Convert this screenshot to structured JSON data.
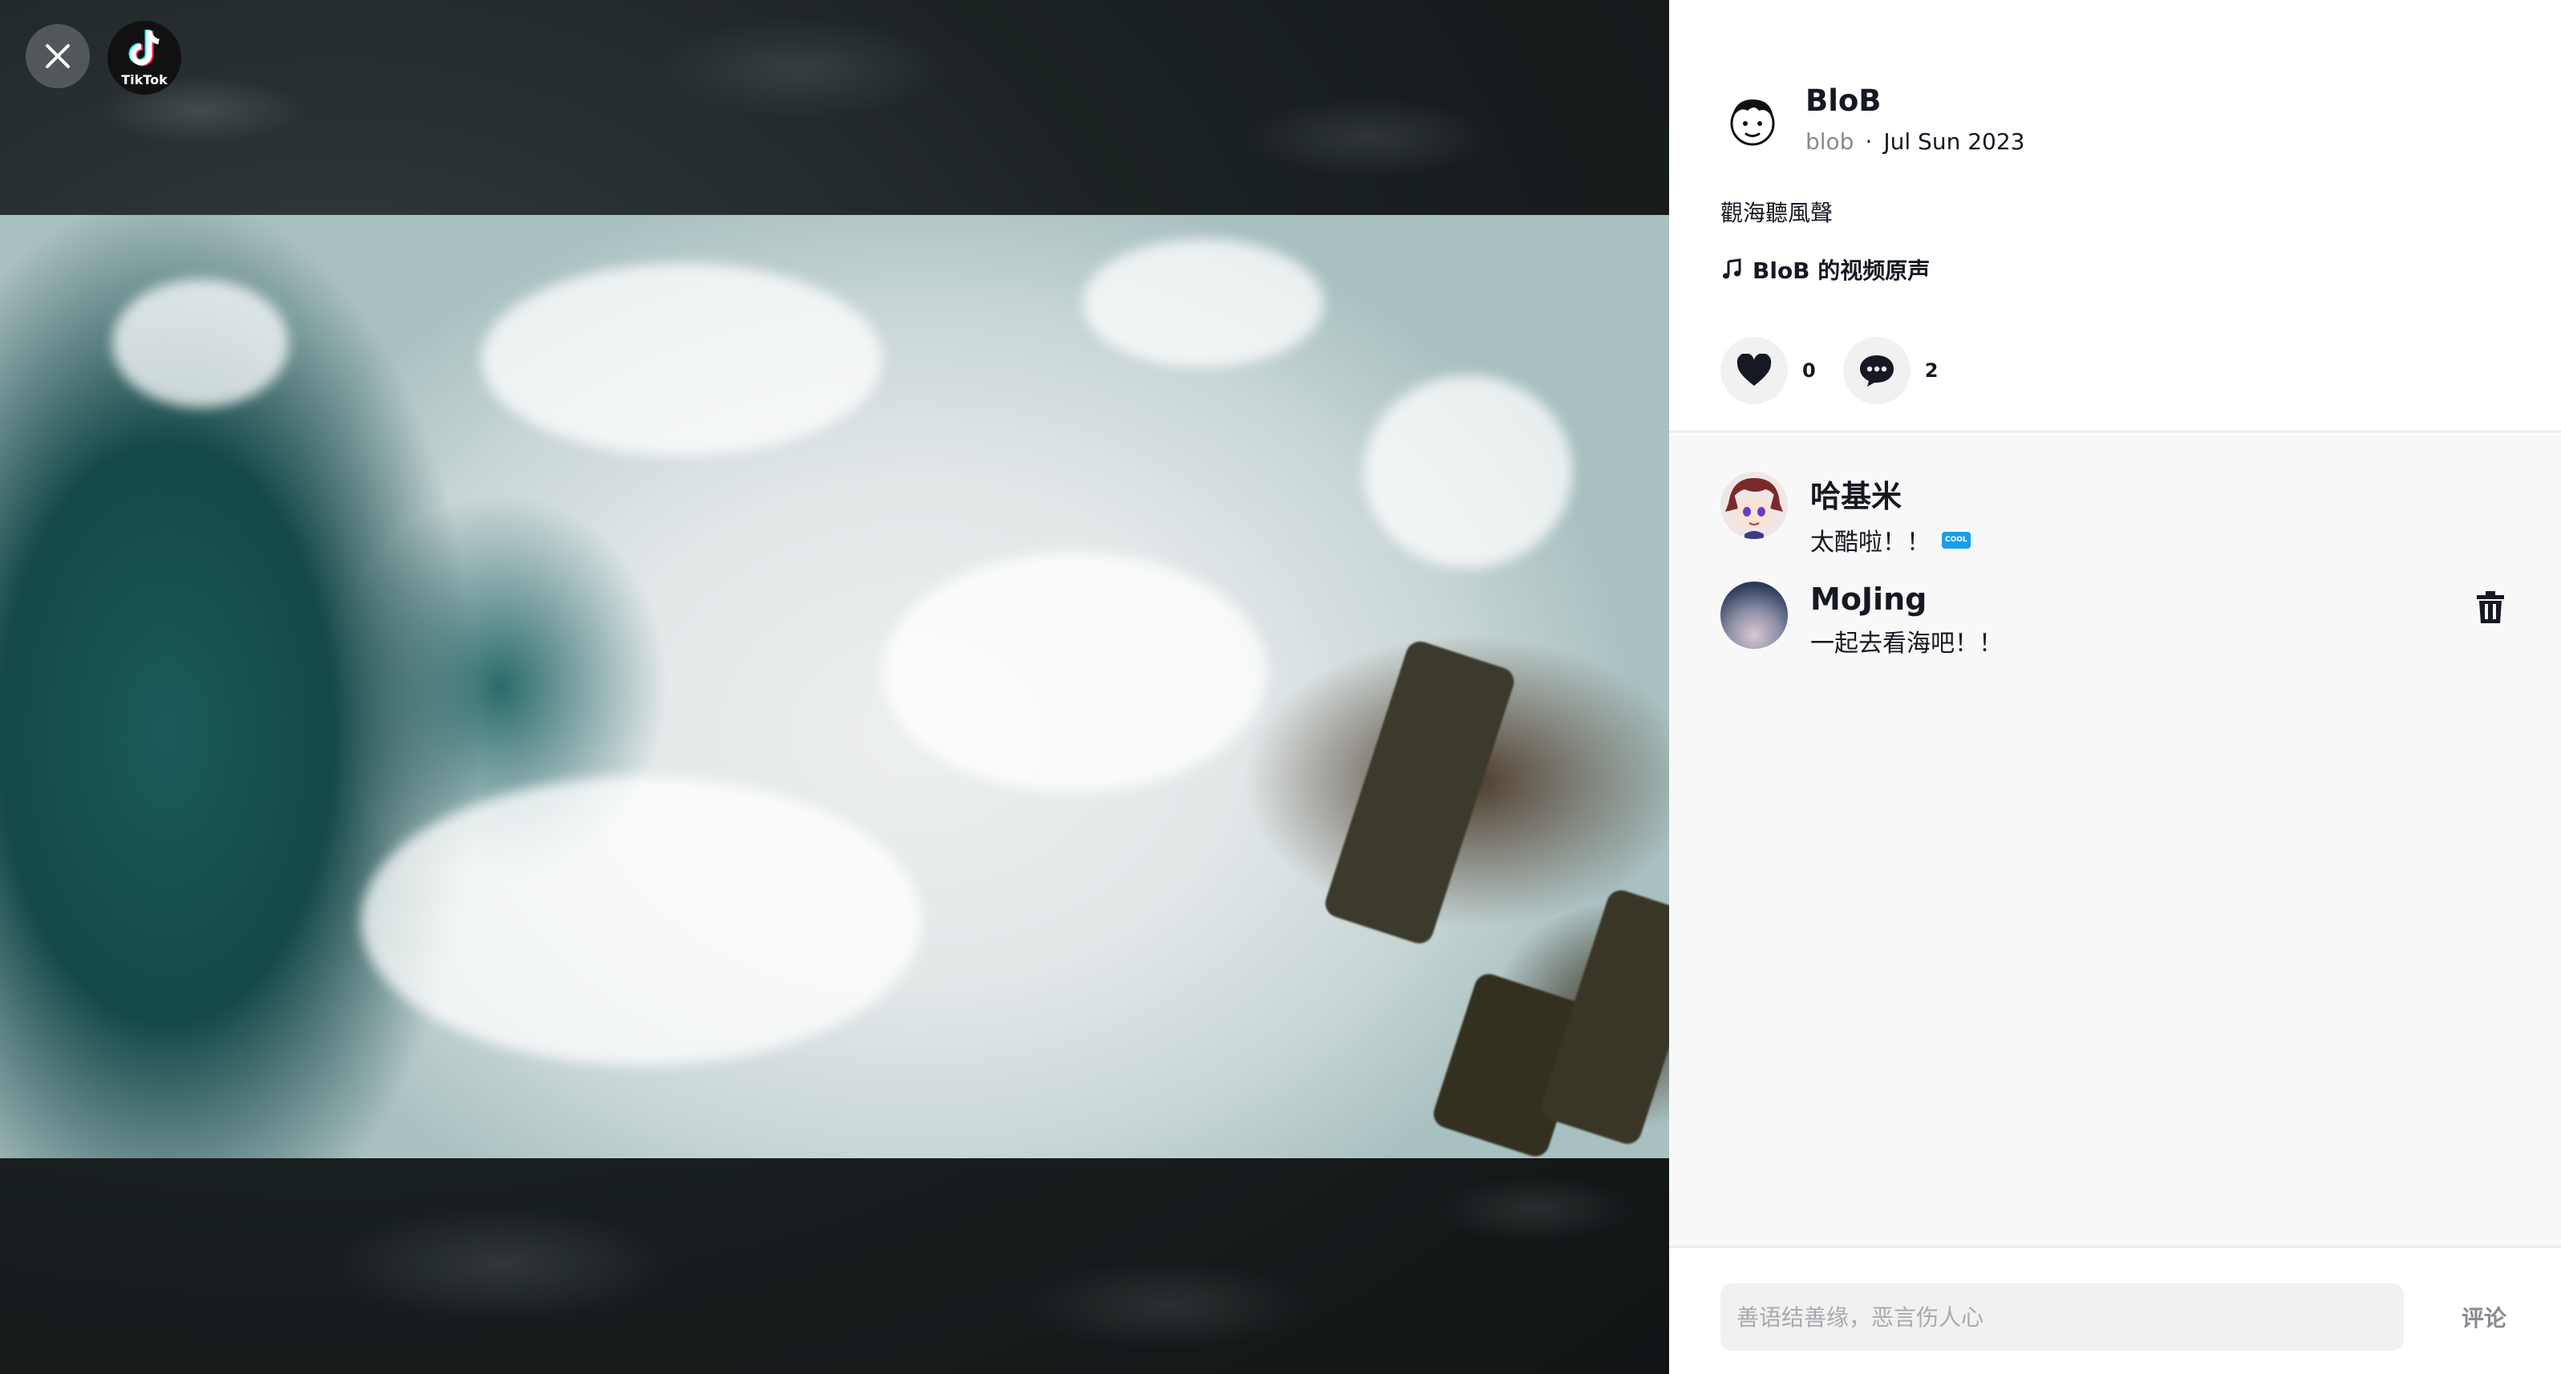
{
  "video": {
    "close_icon": "close-icon",
    "logo_text": "TikTok"
  },
  "post": {
    "author_name": "BloB",
    "author_handle": "blob",
    "date": "Jul Sun 2023",
    "description": "觀海聽風聲",
    "music": "BloB 的视频原声",
    "likes": "0",
    "comments_count": "2"
  },
  "comments": [
    {
      "name": "哈基米",
      "text": "太酷啦！！",
      "sticker": "COOL"
    },
    {
      "name": "MoJing",
      "text": "一起去看海吧！！"
    }
  ],
  "composer": {
    "placeholder": "善语结善缘，恶言伤人心",
    "post_label": "评论"
  },
  "colors": {
    "primary_text": "#161823",
    "secondary_text": "#8a8b91",
    "pill_bg": "#f1f1f2",
    "panel_bg": "#f8f8f8"
  }
}
